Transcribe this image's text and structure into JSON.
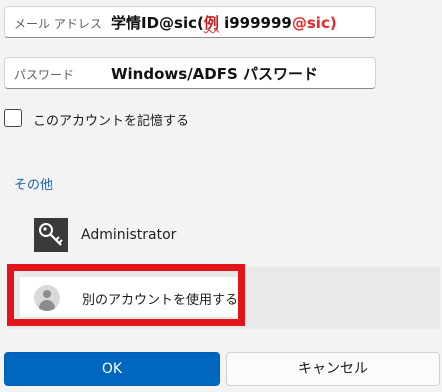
{
  "form": {
    "email_placeholder": "メール アドレス",
    "email_value_prefix": "学情ID@sic(",
    "email_value_example": "例",
    "email_value_mid": " i999999",
    "email_value_suffix": "@sic)",
    "password_placeholder": "パスワード",
    "password_value": "Windows/ADFS  パスワード",
    "remember_label": "このアカウントを記憶する"
  },
  "other_section": {
    "title": "その他",
    "accounts": [
      {
        "name": "Administrator",
        "icon": "key-icon"
      }
    ],
    "use_other_label": "別のアカウントを使用する",
    "use_other_icon": "user-avatar-icon"
  },
  "buttons": {
    "ok": "OK",
    "cancel": "キャンセル"
  },
  "colors": {
    "accent": "#0067c0",
    "highlight": "#e2151b",
    "link": "#1a63a8"
  }
}
